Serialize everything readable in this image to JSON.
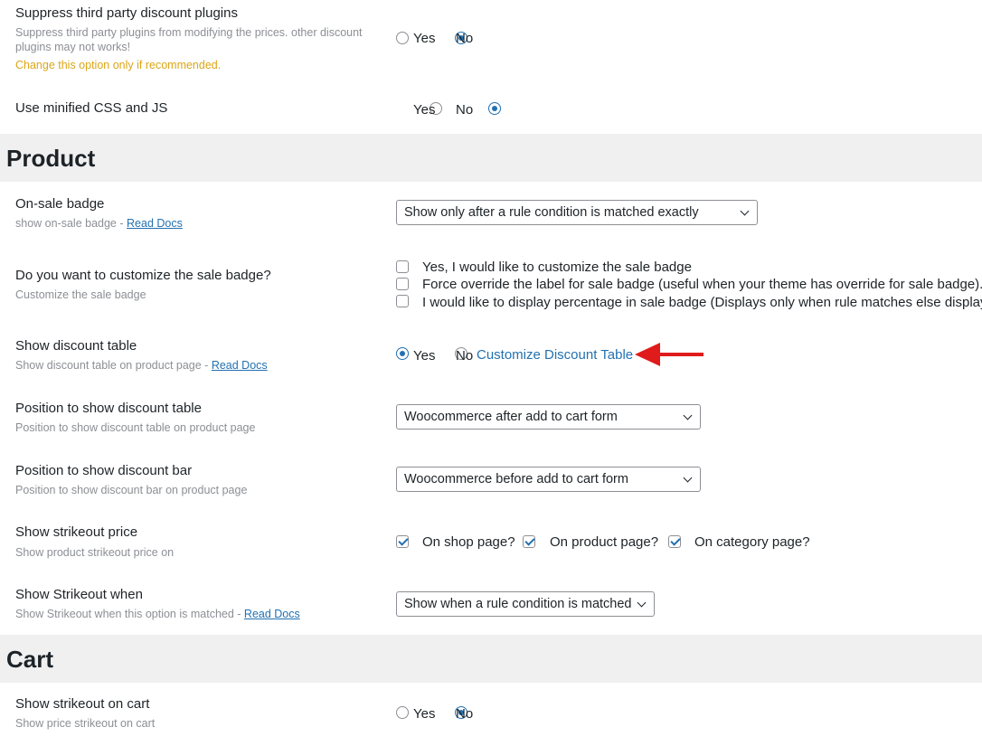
{
  "general": {
    "suppress": {
      "label": "Suppress third party discount plugins",
      "desc_line1": "Suppress third party plugins from modifying the prices. other discount",
      "desc_line2": "plugins may not works!",
      "warning": "Change this option only if recommended.",
      "yes": "Yes",
      "no": "No",
      "selected": "No"
    },
    "minified": {
      "label": "Use minified CSS and JS",
      "yes": "Yes",
      "no": "No",
      "selected": "No"
    }
  },
  "product": {
    "title": "Product",
    "on_sale_badge": {
      "label": "On-sale badge",
      "desc": "show on-sale badge -",
      "link": "Read Docs",
      "value": "Show only after a rule condition is matched exactly"
    },
    "customize_badge": {
      "label": "Do you want to customize the sale badge?",
      "desc": "Customize the sale badge",
      "options": [
        "Yes, I would like to customize the sale badge",
        "Force override the label for sale badge (useful when your theme has override for sale badge).",
        "I would like to display percentage in sale badge (Displays only when rule matches else displays default"
      ]
    },
    "discount_table": {
      "label": "Show discount table",
      "desc": "Show discount table on product page -",
      "link": "Read Docs",
      "yes": "Yes",
      "no": "No",
      "selected": "Yes",
      "customize_link": "Customize Discount Table"
    },
    "table_position": {
      "label": "Position to show discount table",
      "desc": "Position to show discount table on product page",
      "value": "Woocommerce after add to cart form"
    },
    "bar_position": {
      "label": "Position to show discount bar",
      "desc": "Position to show discount bar on product page",
      "value": "Woocommerce before add to cart form"
    },
    "strikeout_price": {
      "label": "Show strikeout price",
      "desc": "Show product strikeout price on",
      "options": [
        "On shop page?",
        "On product page?",
        "On category page?"
      ]
    },
    "strikeout_when": {
      "label": "Show Strikeout when",
      "desc": "Show Strikeout when this option is matched -",
      "link": "Read Docs",
      "value": "Show when a rule condition is matched"
    }
  },
  "cart": {
    "title": "Cart",
    "strikeout_cart": {
      "label": "Show strikeout on cart",
      "desc": "Show price strikeout on cart",
      "yes": "Yes",
      "no": "No",
      "selected": "No"
    }
  },
  "colors": {
    "link": "#2271b1",
    "warning": "#dba617",
    "arrow": "#e01b1b"
  }
}
